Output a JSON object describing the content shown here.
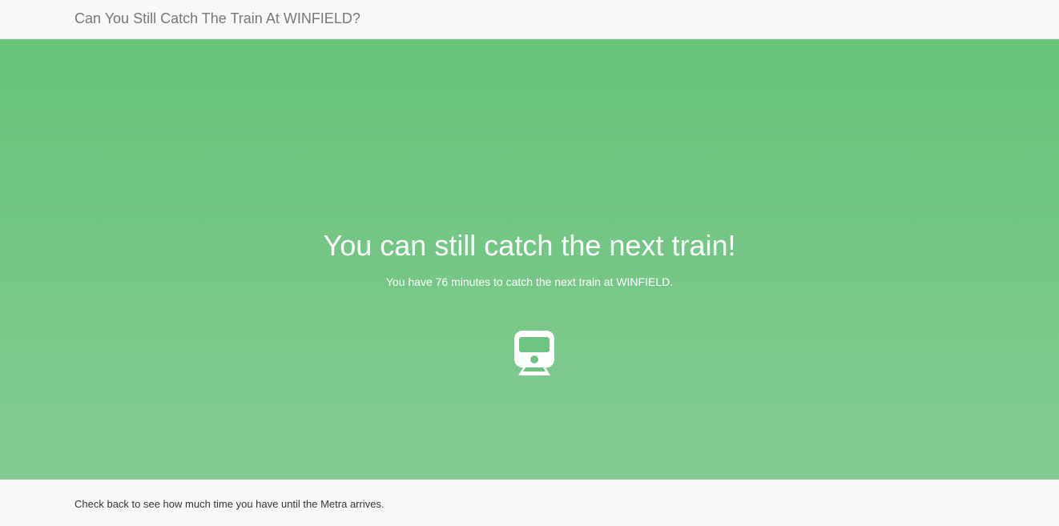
{
  "navbar": {
    "title": "Can You Still Catch The Train At WINFIELD?"
  },
  "hero": {
    "headline": "You can still catch the next train!",
    "message": "You have 76 minutes to catch the next train at WINFIELD.",
    "icon": "train-icon",
    "background_top": "#66c478",
    "background_bottom": "#84c993"
  },
  "footer": {
    "text": "Check back to see how much time you have until the Metra arrives."
  }
}
